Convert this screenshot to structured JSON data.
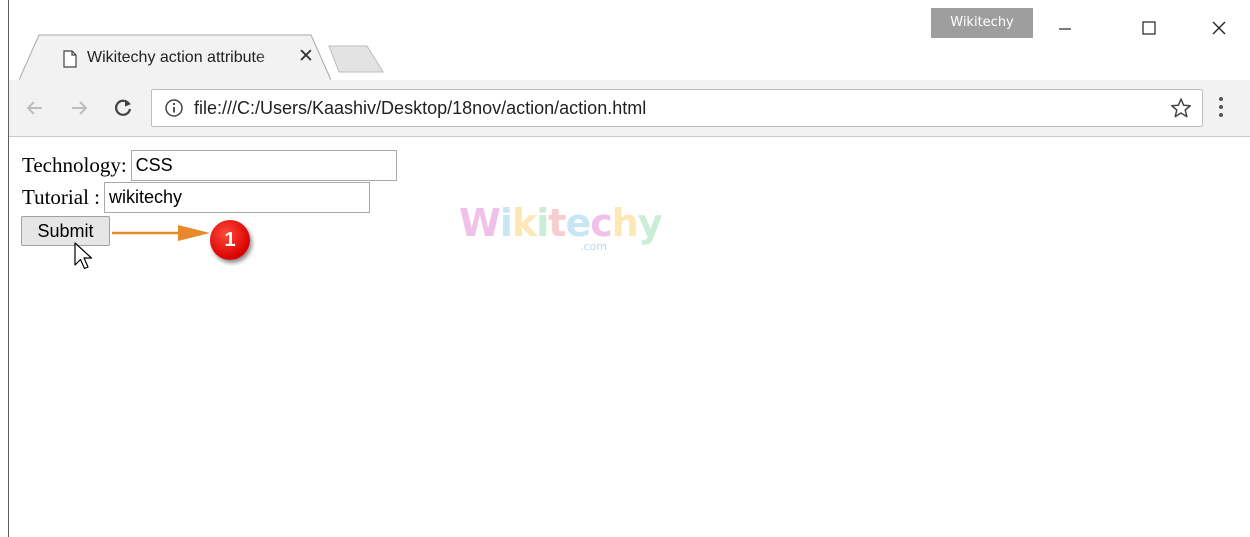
{
  "window": {
    "profile_name": "Wikitechy",
    "minimize_icon": "minimize-icon",
    "maximize_icon": "maximize-icon",
    "close_icon": "close-icon"
  },
  "tab": {
    "title": "Wikitechy action attribute",
    "icon": "document-icon",
    "close_glyph": "✕"
  },
  "toolbar": {
    "url": "file:///C:/Users/Kaashiv/Desktop/18nov/action/action.html"
  },
  "form": {
    "technology_label": "Technology:",
    "technology_value": "CSS",
    "tutorial_label": "Tutorial :",
    "tutorial_value": "wikitechy",
    "submit_label": "Submit"
  },
  "annotation": {
    "step_number": "1",
    "arrow_color": "#e8892b",
    "badge_color": "#d80000"
  },
  "watermark": {
    "text": "Wikitechy",
    "sub": ".com"
  }
}
